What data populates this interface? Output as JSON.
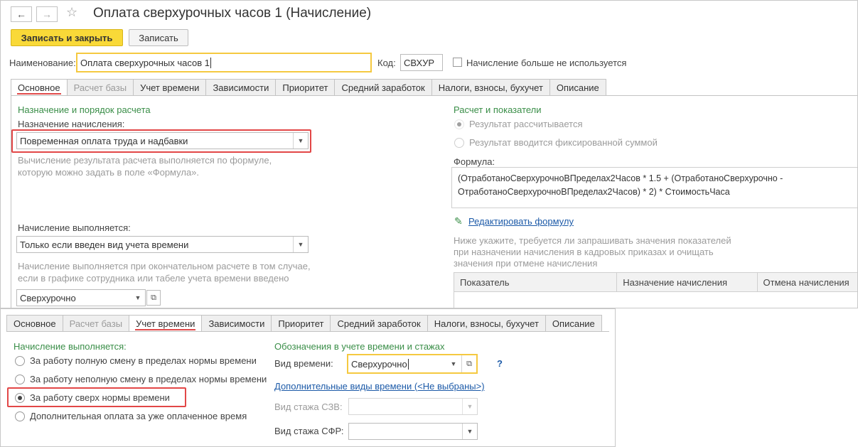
{
  "window": {
    "title": "Оплата сверхурочных часов 1 (Начисление)"
  },
  "toolbar": {
    "save_close_label": "Записать и закрыть",
    "save_label": "Записать"
  },
  "header": {
    "name_label": "Наименование:",
    "name_value": "Оплата сверхурочных часов 1",
    "code_label": "Код:",
    "code_value": "СВХУР",
    "unused_label": "Начисление больше не используется"
  },
  "tabs_top": [
    {
      "label": "Основное"
    },
    {
      "label": "Расчет базы"
    },
    {
      "label": "Учет времени"
    },
    {
      "label": "Зависимости"
    },
    {
      "label": "Приоритет"
    },
    {
      "label": "Средний заработок"
    },
    {
      "label": "Налоги, взносы, бухучет"
    },
    {
      "label": "Описание"
    }
  ],
  "main": {
    "section_title": "Назначение и порядок расчета",
    "purpose_label": "Назначение начисления:",
    "purpose_value": "Повременная оплата труда и надбавки",
    "purpose_hint_1": "Вычисление результата расчета выполняется по формуле,",
    "purpose_hint_2": "которую можно задать в поле «Формула».",
    "performed_label": "Начисление выполняется:",
    "performed_value": "Только если введен вид учета времени",
    "performed_hint_1": "Начисление выполняется при окончательном расчете в том случае,",
    "performed_hint_2": "если в графике сотрудника или табеле учета времени введено",
    "time_kind_value": "Сверхурочно"
  },
  "right": {
    "section_title": "Расчет и показатели",
    "radio_calc": "Результат рассчитывается",
    "radio_fixed": "Результат вводится фиксированной суммой",
    "formula_label": "Формула:",
    "formula_line_1": "(ОтработаноСверхурочноВПределах2Часов * 1.5 + (ОтработаноСверхурочно -",
    "formula_line_2": "ОтработаноСверхурочноВПределах2Часов) * 2) * СтоимостьЧаса",
    "edit_formula": "Редактировать формулу",
    "indicators_hint_1": "Ниже укажите, требуется ли запрашивать значения показателей",
    "indicators_hint_2": "при назначении начисления в кадровых приказах и очищать",
    "indicators_hint_3": "значения при отмене начисления",
    "table_headers": [
      "Показатель",
      "Назначение начисления",
      "Отмена начисления"
    ]
  },
  "tabs_bottom": [
    {
      "label": "Основное"
    },
    {
      "label": "Расчет базы"
    },
    {
      "label": "Учет времени"
    },
    {
      "label": "Зависимости"
    },
    {
      "label": "Приоритет"
    },
    {
      "label": "Средний заработок"
    },
    {
      "label": "Налоги, взносы, бухучет"
    },
    {
      "label": "Описание"
    }
  ],
  "bottom": {
    "performed_title": "Начисление выполняется:",
    "opt_full": "За работу полную смену в пределах нормы времени",
    "opt_partial": "За работу неполную смену в пределах нормы времени",
    "opt_over": "За работу сверх нормы времени",
    "opt_extra": "Дополнительная оплата за уже оплаченное время",
    "designations_title": "Обозначения в учете времени и стажах",
    "time_kind_label": "Вид времени:",
    "time_kind_value": "Сверхурочно",
    "help": "?",
    "extra_kinds_link": "Дополнительные виды времени (<Не выбраны>)",
    "szv_label": "Вид стажа СЗВ:",
    "sfr_label": "Вид стажа СФР:"
  }
}
